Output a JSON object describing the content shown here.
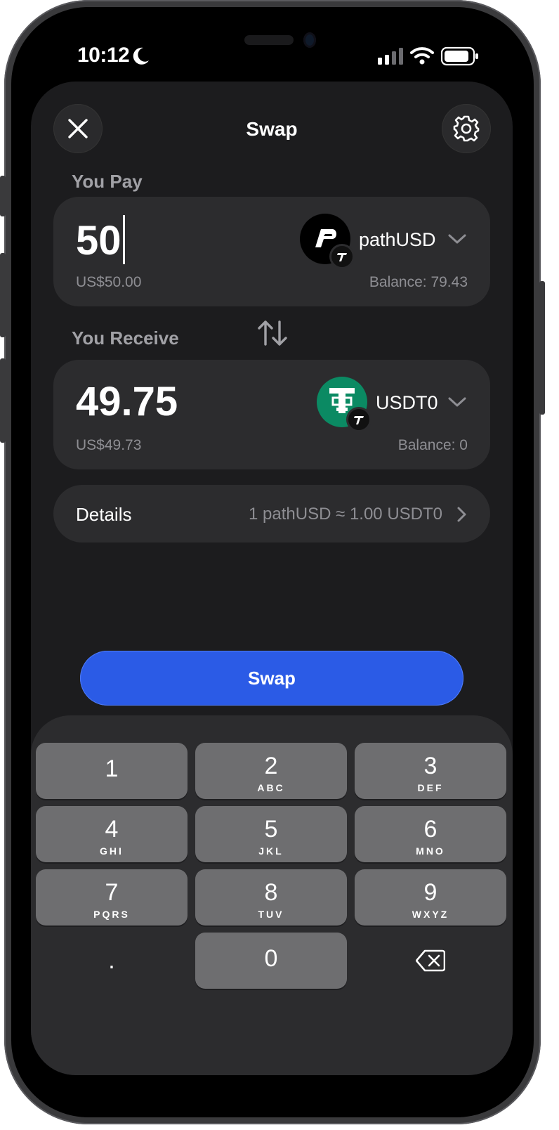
{
  "status_bar": {
    "time": "10:12"
  },
  "header": {
    "title": "Swap"
  },
  "pay": {
    "label": "You Pay",
    "amount": "50",
    "fiat": "US$50.00",
    "token": "pathUSD",
    "balance": "Balance: 79.43"
  },
  "receive": {
    "label": "You Receive",
    "amount": "49.75",
    "fiat": "US$49.73",
    "token": "USDT0",
    "balance": "Balance: 0"
  },
  "details": {
    "label": "Details",
    "rate": "1 pathUSD ≈ 1.00 USDT0"
  },
  "swap_button": {
    "label": "Swap"
  },
  "keypad": {
    "keys": [
      {
        "digit": "1",
        "letters": ""
      },
      {
        "digit": "2",
        "letters": "ABC"
      },
      {
        "digit": "3",
        "letters": "DEF"
      },
      {
        "digit": "4",
        "letters": "GHI"
      },
      {
        "digit": "5",
        "letters": "JKL"
      },
      {
        "digit": "6",
        "letters": "MNO"
      },
      {
        "digit": "7",
        "letters": "PQRS"
      },
      {
        "digit": "8",
        "letters": "TUV"
      },
      {
        "digit": "9",
        "letters": "WXYZ"
      },
      {
        "digit": "0",
        "letters": ""
      }
    ],
    "decimal": "."
  },
  "colors": {
    "accent": "#2b5be6",
    "usdt_green": "#0b8a63",
    "background": "#1c1c1e",
    "card": "#2c2c2e"
  },
  "icons": [
    "close-icon",
    "gear-icon",
    "swap-direction-icon",
    "chevron-down-icon",
    "chevron-right-icon",
    "backspace-icon",
    "moon-icon",
    "signal-icon",
    "wifi-icon",
    "battery-icon"
  ]
}
